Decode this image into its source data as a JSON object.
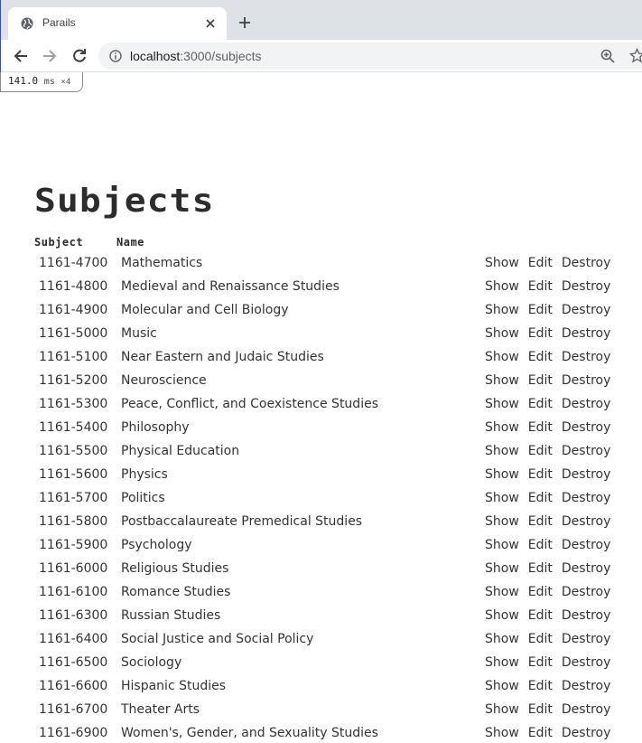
{
  "browser": {
    "tab_title": "Parails",
    "url_host": "localhost",
    "url_path": ":3000/subjects"
  },
  "perf": {
    "value": "141.0",
    "unit": "ms",
    "count": "×4"
  },
  "page": {
    "title": "Subjects",
    "headers": {
      "subject": "Subject",
      "name": "Name"
    },
    "actions": {
      "show": "Show",
      "edit": "Edit",
      "destroy": "Destroy"
    },
    "rows": [
      {
        "code": "1161-4700",
        "name": "Mathematics"
      },
      {
        "code": "1161-4800",
        "name": "Medieval and Renaissance Studies"
      },
      {
        "code": "1161-4900",
        "name": "Molecular and Cell Biology"
      },
      {
        "code": "1161-5000",
        "name": "Music"
      },
      {
        "code": "1161-5100",
        "name": "Near Eastern and Judaic Studies"
      },
      {
        "code": "1161-5200",
        "name": "Neuroscience"
      },
      {
        "code": "1161-5300",
        "name": "Peace, Conflict, and Coexistence Studies"
      },
      {
        "code": "1161-5400",
        "name": "Philosophy"
      },
      {
        "code": "1161-5500",
        "name": "Physical Education"
      },
      {
        "code": "1161-5600",
        "name": "Physics"
      },
      {
        "code": "1161-5700",
        "name": "Politics"
      },
      {
        "code": "1161-5800",
        "name": "Postbaccalaureate Premedical Studies"
      },
      {
        "code": "1161-5900",
        "name": "Psychology"
      },
      {
        "code": "1161-6000",
        "name": "Religious Studies"
      },
      {
        "code": "1161-6100",
        "name": "Romance Studies"
      },
      {
        "code": "1161-6300",
        "name": "Russian Studies"
      },
      {
        "code": "1161-6400",
        "name": "Social Justice and Social Policy"
      },
      {
        "code": "1161-6500",
        "name": "Sociology"
      },
      {
        "code": "1161-6600",
        "name": "Hispanic Studies"
      },
      {
        "code": "1161-6700",
        "name": "Theater Arts"
      },
      {
        "code": "1161-6900",
        "name": "Women's, Gender, and Sexuality Studies"
      }
    ]
  },
  "icons": {
    "favicon": "globe-icon",
    "tab_close": "close-icon",
    "new_tab": "plus-icon",
    "back": "arrow-left-icon",
    "forward": "arrow-right-icon",
    "reload": "reload-icon",
    "site_info": "info-icon",
    "zoom": "zoom-in-icon",
    "bookmark": "star-icon"
  }
}
